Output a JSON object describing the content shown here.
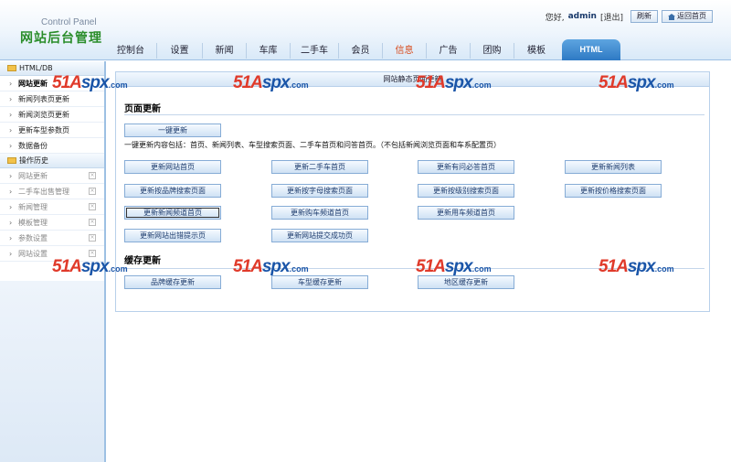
{
  "header": {
    "logo_en": "Control Panel",
    "logo_cn": "网站后台管理",
    "greeting": "您好,",
    "username": "admin",
    "logout": "[退出]",
    "refresh": "刷新",
    "home": "返回首页"
  },
  "nav": {
    "items": [
      "控制台",
      "设置",
      "新闻",
      "车库",
      "二手车",
      "会员",
      "信息",
      "广告",
      "团购",
      "模板"
    ],
    "active": "HTML"
  },
  "sidebar": {
    "group1": "HTML/DB",
    "items1": [
      "网站更新",
      "新闻列表页更新",
      "新闻浏览页更新",
      "更新车型参数页",
      "数据备份"
    ],
    "group2": "操作历史",
    "items2": [
      "网站更新",
      "二手车出售管理",
      "新闻管理",
      "模板管理",
      "参数设置",
      "网站设置"
    ]
  },
  "main": {
    "title": "网站静态页面更新",
    "section1": "页面更新",
    "one_click": "一键更新",
    "description": "一键更新内容包括：首页、新闻列表、车型搜索页面、二手车首页和问答首页。（不包括新闻浏览页面和车系配置页）",
    "buttons": [
      "更新网站首页",
      "更新二手车首页",
      "更新有问必答首页",
      "更新新闻列表",
      "更新按品牌搜索页面",
      "更新按字母搜索页面",
      "更新按级别搜索页面",
      "更新按价格搜索页面",
      "更新新闻频道首页",
      "更新购车频道首页",
      "更新用车频道首页",
      "更新网站出错提示页",
      "更新网站提交成功页"
    ],
    "section2": "缓存更新",
    "cache_buttons": [
      "品牌缓存更新",
      "车型缓存更新",
      "地区缓存更新"
    ]
  },
  "watermark": {
    "a": "51A",
    "b": "spx",
    "c": ".com"
  },
  "colors": {
    "accent": "#2e79c4",
    "logo": "#2a8d2a",
    "watermark": "#e03a2a",
    "highlight": "#d84a1a"
  }
}
